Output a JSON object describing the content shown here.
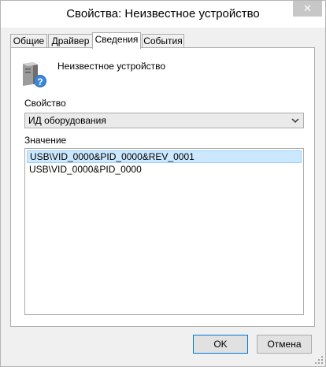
{
  "window": {
    "title": "Свойства: Неизвестное устройство",
    "close_label": "✕"
  },
  "tabs": [
    {
      "label": "Общие",
      "active": false
    },
    {
      "label": "Драйвер",
      "active": false
    },
    {
      "label": "Сведения",
      "active": true
    },
    {
      "label": "События",
      "active": false
    }
  ],
  "device": {
    "name": "Неизвестное устройство",
    "icon": "unknown-device-icon"
  },
  "property": {
    "label": "Свойство",
    "selected": "ИД оборудования"
  },
  "value": {
    "label": "Значение",
    "items": [
      {
        "text": "USB\\VID_0000&PID_0000&REV_0001",
        "selected": true
      },
      {
        "text": "USB\\VID_0000&PID_0000",
        "selected": false
      }
    ]
  },
  "buttons": {
    "ok": "OK",
    "cancel": "Отмена"
  },
  "colors": {
    "selection_bg": "#cce8ff",
    "selection_border": "#99d1ff",
    "default_button_border": "#0078d7",
    "close_button_bg": "#c7c7c7"
  }
}
